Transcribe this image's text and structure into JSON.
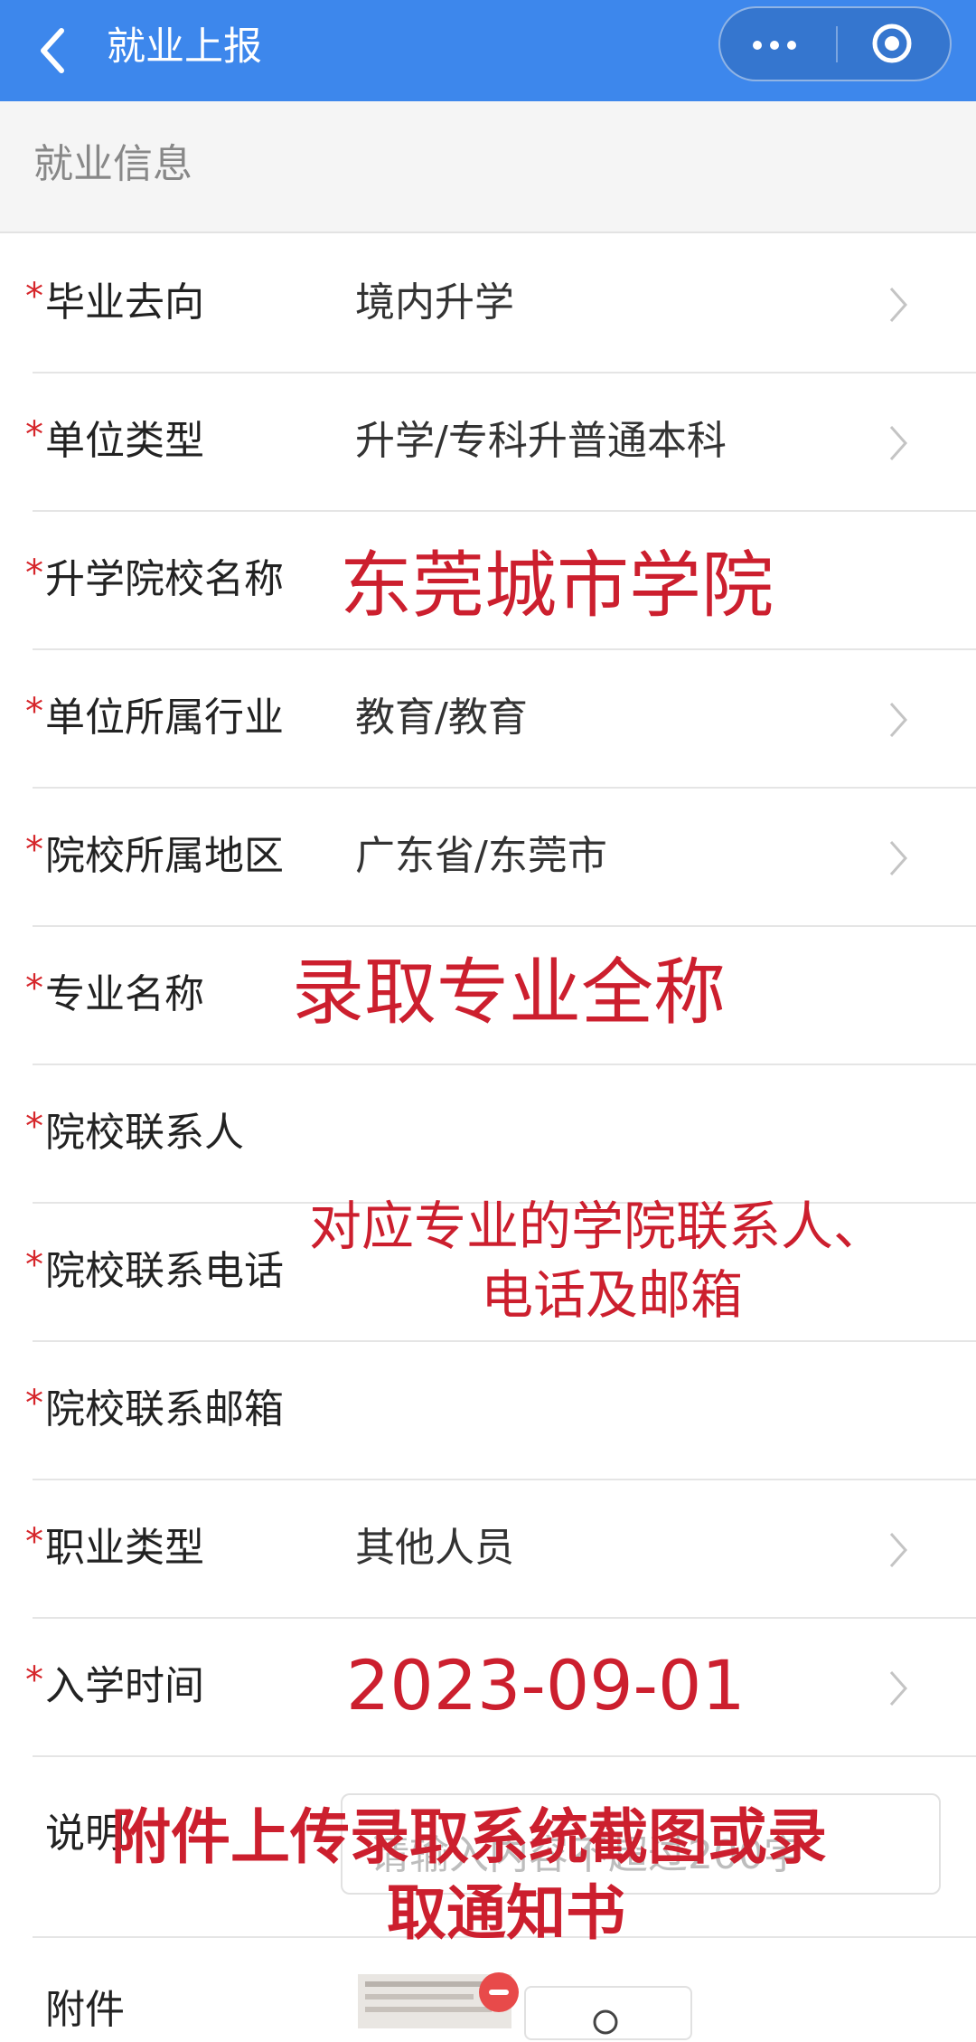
{
  "header": {
    "title": "就业上报",
    "back_icon": "chevron-left-icon",
    "more_icon": "more-dots-icon",
    "close_icon": "target-close-icon",
    "bg_color": "#3d87ec"
  },
  "section": {
    "title": "就业信息"
  },
  "fields": [
    {
      "label": "毕业去向",
      "required": true,
      "value": "境内升学",
      "picker": true
    },
    {
      "label": "单位类型",
      "required": true,
      "value": "升学/专科升普通本科",
      "picker": true
    },
    {
      "label": "升学院校名称",
      "required": true,
      "value": "",
      "picker": false
    },
    {
      "label": "单位所属行业",
      "required": true,
      "value": "教育/教育",
      "picker": true
    },
    {
      "label": "院校所属地区",
      "required": true,
      "value": "广东省/东莞市",
      "picker": true
    },
    {
      "label": "专业名称",
      "required": true,
      "value": "",
      "picker": false
    },
    {
      "label": "院校联系人",
      "required": true,
      "value": "",
      "picker": false
    },
    {
      "label": "院校联系电话",
      "required": true,
      "value": "",
      "picker": false
    },
    {
      "label": "院校联系邮箱",
      "required": true,
      "value": "",
      "picker": false
    },
    {
      "label": "职业类型",
      "required": true,
      "value": "其他人员",
      "picker": true
    },
    {
      "label": "入学时间",
      "required": true,
      "value": "",
      "picker": true
    },
    {
      "label": "说明",
      "required": false,
      "placeholder": "请输入内容不超过200字"
    },
    {
      "label": "附件",
      "required": false
    }
  ],
  "annotations": {
    "school_name": "东莞城市学院",
    "major_name": "录取专业全称",
    "contact_line1": "对应专业的学院联系人、",
    "contact_line2": "电话及邮箱",
    "enroll_date": "2023-09-01",
    "attach_line1": "附件上传录取系统截图或录",
    "attach_line2": "取通知书"
  },
  "colors": {
    "required_star": "#d6262b",
    "annotation_red": "#cc1f2e"
  }
}
